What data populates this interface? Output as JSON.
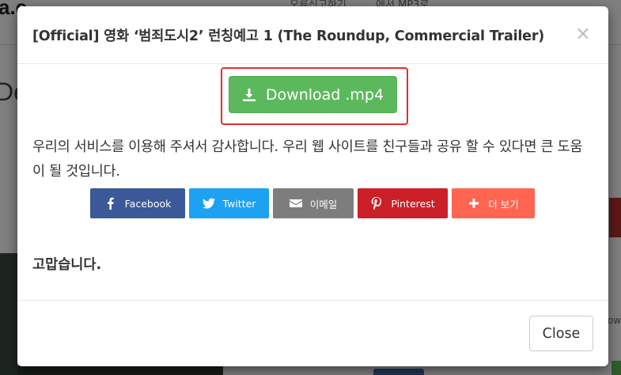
{
  "background": {
    "logo_text": "a.c",
    "heading_text": "De",
    "nav_text": "... ... ... ... 오류신고하기  ... ... 에서 MP3로",
    "side_text": "ow"
  },
  "modal": {
    "title": "[Official] 영화 ‘범죄도시2’ 런칭예고 1 (The Roundup, Commercial Trailer)",
    "close_x": "×",
    "download_label": "Download .mp4",
    "thanks_text": "우리의 서비스를 이용해 주셔서 감사합니다. 우리 웹 사이트를 친구들과 공유 할 수 있다면 큰 도움이 될 것입니다.",
    "share": {
      "facebook": "Facebook",
      "twitter": "Twitter",
      "email": "이메일",
      "pinterest": "Pinterest",
      "more": "더 보기"
    },
    "closing_text": "고맙습니다.",
    "close_button": "Close"
  },
  "colors": {
    "download_green": "#5cb85c",
    "highlight_red": "#e03030",
    "facebook": "#3b5998",
    "twitter": "#1da1f2",
    "email": "#7d7d7d",
    "pinterest": "#cb2027",
    "more": "#ff6550"
  }
}
